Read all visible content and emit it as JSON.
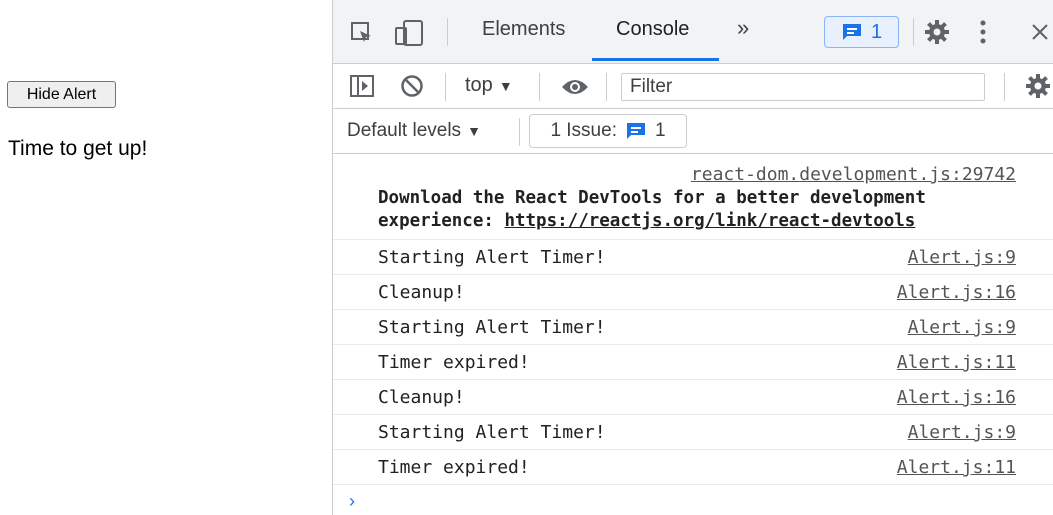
{
  "page": {
    "hide_alert_button": "Hide Alert",
    "alert_message": "Time to get up!"
  },
  "devtools": {
    "tabs": [
      {
        "label": "Elements",
        "active": false
      },
      {
        "label": "Console",
        "active": true
      }
    ],
    "more_tabs_glyph": "»",
    "issues_badge_count": "1",
    "context": "top",
    "filter_placeholder": "Filter",
    "levels_label": "Default levels",
    "issues_button_label": "1 Issue:",
    "issues_button_count": "1",
    "accent_color": "#1a73e8"
  },
  "console": {
    "devtools_message": {
      "source": "react-dom.development.js:29742",
      "line1": "Download the React DevTools for a better development",
      "line2_prefix": "experience: ",
      "line2_link": "https://reactjs.org/link/react-devtools"
    },
    "messages": [
      {
        "text": "Starting Alert Timer!",
        "source": "Alert.js:9"
      },
      {
        "text": "Cleanup!",
        "source": "Alert.js:16"
      },
      {
        "text": "Starting Alert Timer!",
        "source": "Alert.js:9"
      },
      {
        "text": "Timer expired!",
        "source": "Alert.js:11"
      },
      {
        "text": "Cleanup!",
        "source": "Alert.js:16"
      },
      {
        "text": "Starting Alert Timer!",
        "source": "Alert.js:9"
      },
      {
        "text": "Timer expired!",
        "source": "Alert.js:11"
      }
    ],
    "prompt_glyph": "›"
  }
}
